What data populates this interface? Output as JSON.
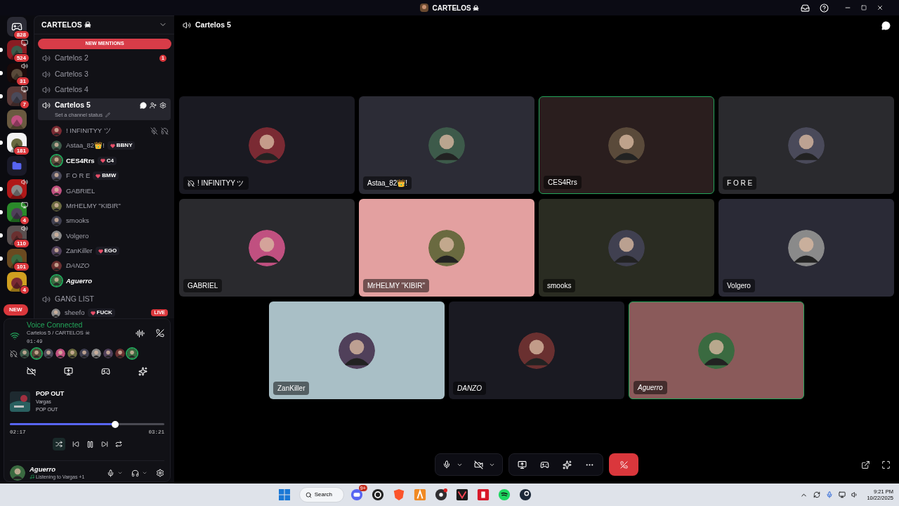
{
  "titlebar": {
    "title": "CARTELOS ☠"
  },
  "servers": [
    {
      "kind": "home",
      "badge": "828",
      "streaming": false,
      "in_voice": false,
      "unread": false
    },
    {
      "kind": "server",
      "badge": "524",
      "streaming": true,
      "in_voice": false,
      "unread": true
    },
    {
      "kind": "server",
      "badge": "31",
      "streaming": false,
      "in_voice": true,
      "unread": true
    },
    {
      "kind": "server",
      "badge": "7",
      "streaming": true,
      "in_voice": false,
      "unread": true
    },
    {
      "kind": "server",
      "streaming": false,
      "in_voice": false,
      "unread": false
    },
    {
      "kind": "server",
      "badge": "181",
      "streaming": false,
      "in_voice": false,
      "unread": true
    },
    {
      "kind": "folder",
      "streaming": false,
      "in_voice": false,
      "unread": false
    },
    {
      "kind": "server",
      "streaming": false,
      "in_voice": true,
      "unread": true
    },
    {
      "kind": "server",
      "badge": "4",
      "streaming": true,
      "in_voice": false,
      "unread": true
    },
    {
      "kind": "server",
      "badge": "110",
      "streaming": false,
      "in_voice": true,
      "unread": true
    },
    {
      "kind": "server",
      "badge": "101",
      "streaming": false,
      "in_voice": false,
      "unread": true
    },
    {
      "kind": "server",
      "badge": "4",
      "streaming": false,
      "in_voice": false,
      "unread": false
    }
  ],
  "new_pill": "NEW",
  "guild": {
    "name": "CARTELOS ☠",
    "banner": "NEW MENTIONS"
  },
  "channels": [
    {
      "name": "Cartelos 2",
      "badge": "1",
      "selected": false
    },
    {
      "name": "Cartelos 3",
      "selected": false
    },
    {
      "name": "Cartelos 4",
      "selected": false
    },
    {
      "name": "Cartelos 5",
      "selected": true,
      "status": "Set a channel status"
    }
  ],
  "members": [
    {
      "name": "! INFINITYY ツ",
      "speaking": false,
      "italic": false,
      "deafened": true
    },
    {
      "name": "Astaa_82👑!",
      "tag": "BBNY",
      "speaking": false,
      "italic": false,
      "deafened": false
    },
    {
      "name": "CES4Rrs",
      "tag": "C4",
      "speaking": true,
      "italic": false,
      "deafened": false
    },
    {
      "name": "F O R E",
      "tag": "BMW",
      "speaking": false,
      "italic": false,
      "deafened": false
    },
    {
      "name": "GABRIEL",
      "speaking": false,
      "italic": false,
      "deafened": false
    },
    {
      "name": "MrHELMY \"KIBIR\"",
      "speaking": false,
      "italic": false,
      "deafened": false
    },
    {
      "name": "smooks",
      "speaking": false,
      "italic": false,
      "deafened": false
    },
    {
      "name": "Volgero",
      "speaking": false,
      "italic": false,
      "deafened": false
    },
    {
      "name": "ZanKiller",
      "tag": "EGO",
      "speaking": false,
      "italic": false,
      "deafened": false
    },
    {
      "name": "DANZO",
      "speaking": false,
      "italic": true,
      "deafened": false
    },
    {
      "name": "Aguerro",
      "speaking": true,
      "italic": true,
      "deafened": false
    }
  ],
  "other_channel": {
    "name": "GANG LIST",
    "member": "sheefo",
    "tag": "FUCK",
    "live": "LIVE"
  },
  "voice": {
    "status": "Voice Connected",
    "location": "Cartelos 5 / CARTELOS ☠",
    "time": "01:49"
  },
  "music": {
    "title": "POP OUT",
    "artist": "Vargas",
    "album": "POP OUT",
    "level": 0.68,
    "elapsed": "02:17",
    "total": "03:21",
    "shuffle": true
  },
  "user": {
    "name": "Aguerro",
    "activity": "Listening to Vargas +1"
  },
  "header": {
    "channel": "Cartelos 5"
  },
  "tiles": [
    {
      "name": "! INFINITYY ツ",
      "speaking": false,
      "italic": false,
      "deafened": true,
      "color": "#1a1a22"
    },
    {
      "name": "Astaa_82👑!",
      "speaking": false,
      "italic": false,
      "deafened": false,
      "color": "#2c2c36"
    },
    {
      "name": "CES4Rrs",
      "speaking": true,
      "italic": false,
      "deafened": false,
      "color": "#2a1e1e"
    },
    {
      "name": "F O R E",
      "speaking": false,
      "italic": false,
      "deafened": false,
      "color": "#2a2a2e"
    },
    {
      "name": "GABRIEL",
      "speaking": false,
      "italic": false,
      "deafened": false,
      "color": "#2a2a2e"
    },
    {
      "name": "MrHELMY \"KIBIR\"",
      "speaking": false,
      "italic": false,
      "deafened": false,
      "color": "#e3a0a0"
    },
    {
      "name": "smooks",
      "speaking": false,
      "italic": false,
      "deafened": false,
      "color": "#2a2c22"
    },
    {
      "name": "Volgero",
      "speaking": false,
      "italic": false,
      "deafened": false,
      "color": "#2a2a36"
    },
    {
      "name": "ZanKiller",
      "speaking": false,
      "italic": false,
      "deafened": false,
      "color": "#a9bfc6"
    },
    {
      "name": "DANZO",
      "speaking": false,
      "italic": true,
      "deafened": false,
      "color": "#1a1a22"
    },
    {
      "name": "Aguerro",
      "speaking": true,
      "italic": true,
      "deafened": false,
      "color": "#8a5a5a"
    }
  ],
  "taskbar": {
    "search": "Search",
    "apps": [
      {
        "kind": "chat",
        "badge": "9+"
      },
      {
        "kind": "ring"
      },
      {
        "kind": "shield"
      },
      {
        "kind": "tile"
      },
      {
        "kind": "camera"
      },
      {
        "kind": "mark"
      },
      {
        "kind": "lock"
      },
      {
        "kind": "music"
      },
      {
        "kind": "steam"
      }
    ],
    "time": "9:21 PM",
    "date": "10/22/2025"
  }
}
